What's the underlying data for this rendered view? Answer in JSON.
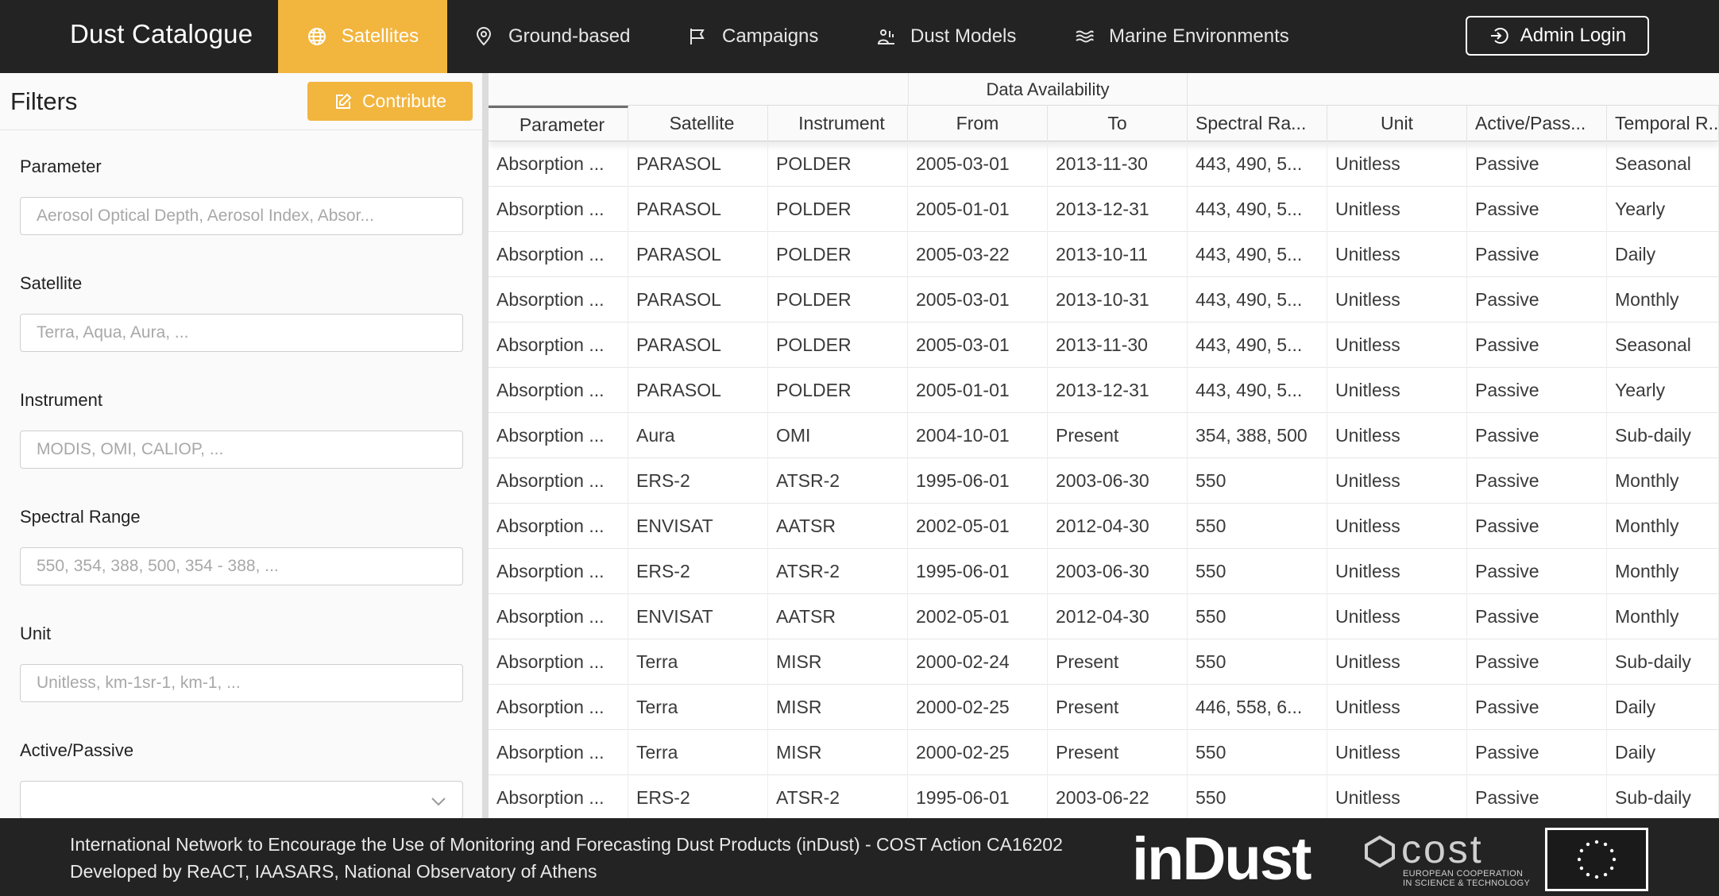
{
  "app": {
    "title": "Dust Catalogue"
  },
  "nav": {
    "items": [
      {
        "label": "Satellites",
        "icon": "globe-icon",
        "active": true
      },
      {
        "label": "Ground-based",
        "icon": "location-pin-icon",
        "active": false
      },
      {
        "label": "Campaigns",
        "icon": "flag-icon",
        "active": false
      },
      {
        "label": "Dust Models",
        "icon": "person-chart-icon",
        "active": false
      },
      {
        "label": "Marine Environments",
        "icon": "waves-icon",
        "active": false
      }
    ],
    "admin_label": "Admin Login"
  },
  "sidebar": {
    "title": "Filters",
    "contribute_label": "Contribute",
    "filters": [
      {
        "label": "Parameter",
        "placeholder": "Aerosol Optical Depth, Aerosol Index, Absor..."
      },
      {
        "label": "Satellite",
        "placeholder": "Terra, Aqua, Aura, ..."
      },
      {
        "label": "Instrument",
        "placeholder": "MODIS, OMI, CALIOP, ..."
      },
      {
        "label": "Spectral Range",
        "placeholder": "550, 354, 388, 500, 354 - 388, ..."
      },
      {
        "label": "Unit",
        "placeholder": "Unitless, km-1sr-1, km-1, ..."
      },
      {
        "label": "Active/Passive",
        "placeholder": ""
      }
    ]
  },
  "table": {
    "group_header": "Data Availability",
    "columns": [
      "Parameter",
      "Satellite",
      "Instrument",
      "From",
      "To",
      "Spectral Ra...",
      "Unit",
      "Active/Pass...",
      "Temporal R..."
    ],
    "rows": [
      [
        "Absorption ...",
        "PARASOL",
        "POLDER",
        "2005-03-01",
        "2013-11-30",
        "443, 490, 5...",
        "Unitless",
        "Passive",
        "Seasonal"
      ],
      [
        "Absorption ...",
        "PARASOL",
        "POLDER",
        "2005-01-01",
        "2013-12-31",
        "443, 490, 5...",
        "Unitless",
        "Passive",
        "Yearly"
      ],
      [
        "Absorption ...",
        "PARASOL",
        "POLDER",
        "2005-03-22",
        "2013-10-11",
        "443, 490, 5...",
        "Unitless",
        "Passive",
        "Daily"
      ],
      [
        "Absorption ...",
        "PARASOL",
        "POLDER",
        "2005-03-01",
        "2013-10-31",
        "443, 490, 5...",
        "Unitless",
        "Passive",
        "Monthly"
      ],
      [
        "Absorption ...",
        "PARASOL",
        "POLDER",
        "2005-03-01",
        "2013-11-30",
        "443, 490, 5...",
        "Unitless",
        "Passive",
        "Seasonal"
      ],
      [
        "Absorption ...",
        "PARASOL",
        "POLDER",
        "2005-01-01",
        "2013-12-31",
        "443, 490, 5...",
        "Unitless",
        "Passive",
        "Yearly"
      ],
      [
        "Absorption ...",
        "Aura",
        "OMI",
        "2004-10-01",
        "Present",
        "354, 388, 500",
        "Unitless",
        "Passive",
        "Sub-daily"
      ],
      [
        "Absorption ...",
        "ERS-2",
        "ATSR-2",
        "1995-06-01",
        "2003-06-30",
        "550",
        "Unitless",
        "Passive",
        "Monthly"
      ],
      [
        "Absorption ...",
        "ENVISAT",
        "AATSR",
        "2002-05-01",
        "2012-04-30",
        "550",
        "Unitless",
        "Passive",
        "Monthly"
      ],
      [
        "Absorption ...",
        "ERS-2",
        "ATSR-2",
        "1995-06-01",
        "2003-06-30",
        "550",
        "Unitless",
        "Passive",
        "Monthly"
      ],
      [
        "Absorption ...",
        "ENVISAT",
        "AATSR",
        "2002-05-01",
        "2012-04-30",
        "550",
        "Unitless",
        "Passive",
        "Monthly"
      ],
      [
        "Absorption ...",
        "Terra",
        "MISR",
        "2000-02-24",
        "Present",
        "550",
        "Unitless",
        "Passive",
        "Sub-daily"
      ],
      [
        "Absorption ...",
        "Terra",
        "MISR",
        "2000-02-25",
        "Present",
        "446, 558, 6...",
        "Unitless",
        "Passive",
        "Daily"
      ],
      [
        "Absorption ...",
        "Terra",
        "MISR",
        "2000-02-25",
        "Present",
        "550",
        "Unitless",
        "Passive",
        "Daily"
      ],
      [
        "Absorption ...",
        "ERS-2",
        "ATSR-2",
        "1995-06-01",
        "2003-06-22",
        "550",
        "Unitless",
        "Passive",
        "Sub-daily"
      ]
    ]
  },
  "footer": {
    "line1": "International Network to Encourage the Use of Monitoring and Forecasting Dust Products (inDust) - COST Action CA16202",
    "line2": "Developed by ReACT, IAASARS, National Observatory of Athens",
    "indust_logo_text": "inDust",
    "cost_logo_word": "cost",
    "cost_logo_sub1": "EUROPEAN COOPERATION",
    "cost_logo_sub2": "IN SCIENCE & TECHNOLOGY"
  },
  "colors": {
    "accent": "#f2b53e",
    "topbar": "#232323",
    "footer": "#232323"
  }
}
